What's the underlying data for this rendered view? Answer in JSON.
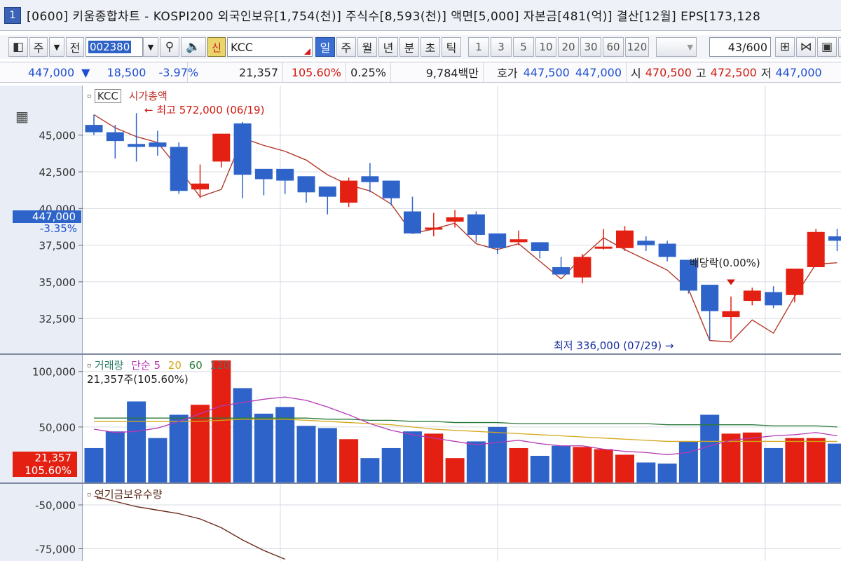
{
  "titlebar": {
    "window_number": "1",
    "title": "[0600] 키움종합차트 - KOSPI200 외국인보유[1,754(천)] 주식수[8,593(천)] 액면[5,000] 자본금[481(억)] 결산[12월] EPS[173,128"
  },
  "toolbar": {
    "market": "주",
    "prev_label": "전",
    "code": "002380",
    "shin": "신",
    "name": "KCC",
    "periods": [
      "일",
      "주",
      "월",
      "년",
      "분",
      "초",
      "틱"
    ],
    "active_period": "일",
    "intervals": [
      "1",
      "3",
      "5",
      "10",
      "20",
      "30",
      "60",
      "120"
    ],
    "count": "43",
    "count_total": "/600"
  },
  "infobar": {
    "price": "447,000",
    "down_arrow": "▼",
    "change": "18,500",
    "change_pct": "-3.97%",
    "volume": "21,357",
    "volume_ratio": "105.60%",
    "turnover": "0.25%",
    "amount": "9,784백만",
    "hoga_label": "호가",
    "ask": "447,500",
    "bid": "447,000",
    "open_label": "시",
    "open": "470,500",
    "high_label": "고",
    "high": "472,500",
    "low_label": "저",
    "low": "447,000"
  },
  "colors": {
    "up": "#e32012",
    "down": "#2e64c9",
    "ma_line": "#b23a2a"
  },
  "chart_data": [
    {
      "type": "candlestick",
      "title": "KCC",
      "overlay_label": "시가총액",
      "ylim": [
        30500,
        48000
      ],
      "yticks": [
        "45,000",
        "42,500",
        "40,000",
        "37,500",
        "35,000",
        "32,500"
      ],
      "current_price_label": "447,000",
      "current_change_label": "-3.35%",
      "annotations": {
        "high": "최고 572,000 (06/19)",
        "low": "최저 336,000 (07/29)",
        "dividend": "배당락(0.00%)"
      },
      "candles": [
        {
          "o": 45700,
          "h": 46400,
          "l": 45000,
          "c": 45200
        },
        {
          "o": 45200,
          "h": 45700,
          "l": 43400,
          "c": 44600
        },
        {
          "o": 44400,
          "h": 46500,
          "l": 43200,
          "c": 44200
        },
        {
          "o": 44500,
          "h": 45300,
          "l": 43600,
          "c": 44200
        },
        {
          "o": 44200,
          "h": 44500,
          "l": 41000,
          "c": 41200
        },
        {
          "o": 41300,
          "h": 43000,
          "l": 40700,
          "c": 41700
        },
        {
          "o": 43200,
          "h": 44700,
          "l": 42800,
          "c": 45100
        },
        {
          "o": 45800,
          "h": 45900,
          "l": 40700,
          "c": 42300
        },
        {
          "o": 42700,
          "h": 42700,
          "l": 40900,
          "c": 42000
        },
        {
          "o": 42700,
          "h": 42700,
          "l": 41000,
          "c": 41900
        },
        {
          "o": 42200,
          "h": 42200,
          "l": 40400,
          "c": 41100
        },
        {
          "o": 41500,
          "h": 41500,
          "l": 39600,
          "c": 40800
        },
        {
          "o": 40400,
          "h": 42100,
          "l": 40100,
          "c": 41900
        },
        {
          "o": 42200,
          "h": 43100,
          "l": 41100,
          "c": 41800
        },
        {
          "o": 41900,
          "h": 41900,
          "l": 40200,
          "c": 40700
        },
        {
          "o": 39800,
          "h": 40800,
          "l": 38300,
          "c": 38300
        },
        {
          "o": 38600,
          "h": 39700,
          "l": 38100,
          "c": 38700
        },
        {
          "o": 39100,
          "h": 39900,
          "l": 38700,
          "c": 39400
        },
        {
          "o": 39600,
          "h": 39800,
          "l": 37700,
          "c": 38200
        },
        {
          "o": 38300,
          "h": 38300,
          "l": 36900,
          "c": 37300
        },
        {
          "o": 37700,
          "h": 38500,
          "l": 37500,
          "c": 37900
        },
        {
          "o": 37700,
          "h": 37700,
          "l": 36600,
          "c": 37100
        },
        {
          "o": 36000,
          "h": 36700,
          "l": 35600,
          "c": 35500
        },
        {
          "o": 35300,
          "h": 36900,
          "l": 34900,
          "c": 36700
        },
        {
          "o": 37300,
          "h": 38600,
          "l": 37200,
          "c": 37400
        },
        {
          "o": 37300,
          "h": 38800,
          "l": 37100,
          "c": 38500
        },
        {
          "o": 37800,
          "h": 38100,
          "l": 37100,
          "c": 37500
        },
        {
          "o": 37600,
          "h": 37800,
          "l": 36400,
          "c": 36700
        },
        {
          "o": 36500,
          "h": 36500,
          "l": 34200,
          "c": 34400
        },
        {
          "o": 34800,
          "h": 34800,
          "l": 31000,
          "c": 33000
        },
        {
          "o": 32600,
          "h": 34000,
          "l": 31100,
          "c": 33000
        },
        {
          "o": 33700,
          "h": 34600,
          "l": 33400,
          "c": 34400
        },
        {
          "o": 34300,
          "h": 34700,
          "l": 33200,
          "c": 33400
        },
        {
          "o": 34100,
          "h": 35900,
          "l": 33600,
          "c": 35900
        },
        {
          "o": 36000,
          "h": 38600,
          "l": 36000,
          "c": 38400
        },
        {
          "o": 38100,
          "h": 38600,
          "l": 37100,
          "c": 37800
        }
      ],
      "ma_line": [
        46400,
        45500,
        44900,
        44500,
        42700,
        40800,
        41300,
        44800,
        44300,
        43900,
        43300,
        42300,
        41600,
        41200,
        40300,
        38300,
        38600,
        39000,
        37600,
        37200,
        37600,
        36400,
        35200,
        36700,
        38000,
        37200,
        36500,
        35800,
        34500,
        31000,
        30900,
        32400,
        31500,
        34000,
        36200,
        36300
      ]
    },
    {
      "type": "bar",
      "title": "거래량",
      "ma_labels": [
        "단순 5",
        "20",
        "60",
        "120"
      ],
      "volume_label": "21,357주(105.60%)",
      "current_value_label": "21,357",
      "current_ratio_label": "105.60%",
      "ylim": [
        0,
        115000
      ],
      "yticks": [
        "100,000",
        "50,000"
      ],
      "values": [
        31000,
        46000,
        73000,
        40000,
        61000,
        70000,
        110000,
        85000,
        62000,
        68000,
        51000,
        49000,
        39000,
        22000,
        31000,
        46000,
        44000,
        22000,
        37000,
        50000,
        31000,
        24000,
        33000,
        32000,
        30000,
        25000,
        18000,
        17000,
        37000,
        61000,
        44000,
        45000,
        31000,
        40000,
        40000,
        35000
      ],
      "ma5": [
        48000,
        45000,
        46000,
        49000,
        55000,
        62000,
        69000,
        72000,
        75000,
        77000,
        74000,
        68000,
        61000,
        53000,
        47000,
        43000,
        40000,
        37000,
        34000,
        36000,
        38000,
        35000,
        33000,
        33000,
        30000,
        28000,
        27000,
        25000,
        27000,
        33000,
        38000,
        40000,
        42000,
        43000,
        45000,
        42000
      ],
      "ma20": [
        55000,
        55000,
        55000,
        55000,
        55000,
        55000,
        56000,
        57000,
        57000,
        57000,
        56000,
        55000,
        54000,
        53000,
        52000,
        50000,
        48000,
        47000,
        46000,
        45000,
        44000,
        43000,
        42000,
        41000,
        40000,
        39000,
        38000,
        37000,
        37000,
        37000,
        37000,
        37000,
        37000,
        37000,
        37000,
        37000
      ],
      "ma60": [
        58000,
        58000,
        58000,
        58000,
        58000,
        58000,
        58000,
        58000,
        58000,
        58000,
        58000,
        57000,
        57000,
        56000,
        56000,
        55000,
        55000,
        54000,
        54000,
        54000,
        53000,
        53000,
        53000,
        53000,
        53000,
        53000,
        53000,
        52000,
        52000,
        52000,
        52000,
        52000,
        51000,
        51000,
        51000,
        50000
      ]
    },
    {
      "type": "line",
      "title": "연기금보유수량",
      "ylim": [
        -82000,
        -38000
      ],
      "yticks": [
        "-50,000",
        "-75,000"
      ],
      "values": [
        -45000,
        -48000,
        -51000,
        -53000,
        -55000,
        -58000,
        -63000,
        -70000,
        -76000,
        -81000
      ]
    }
  ]
}
